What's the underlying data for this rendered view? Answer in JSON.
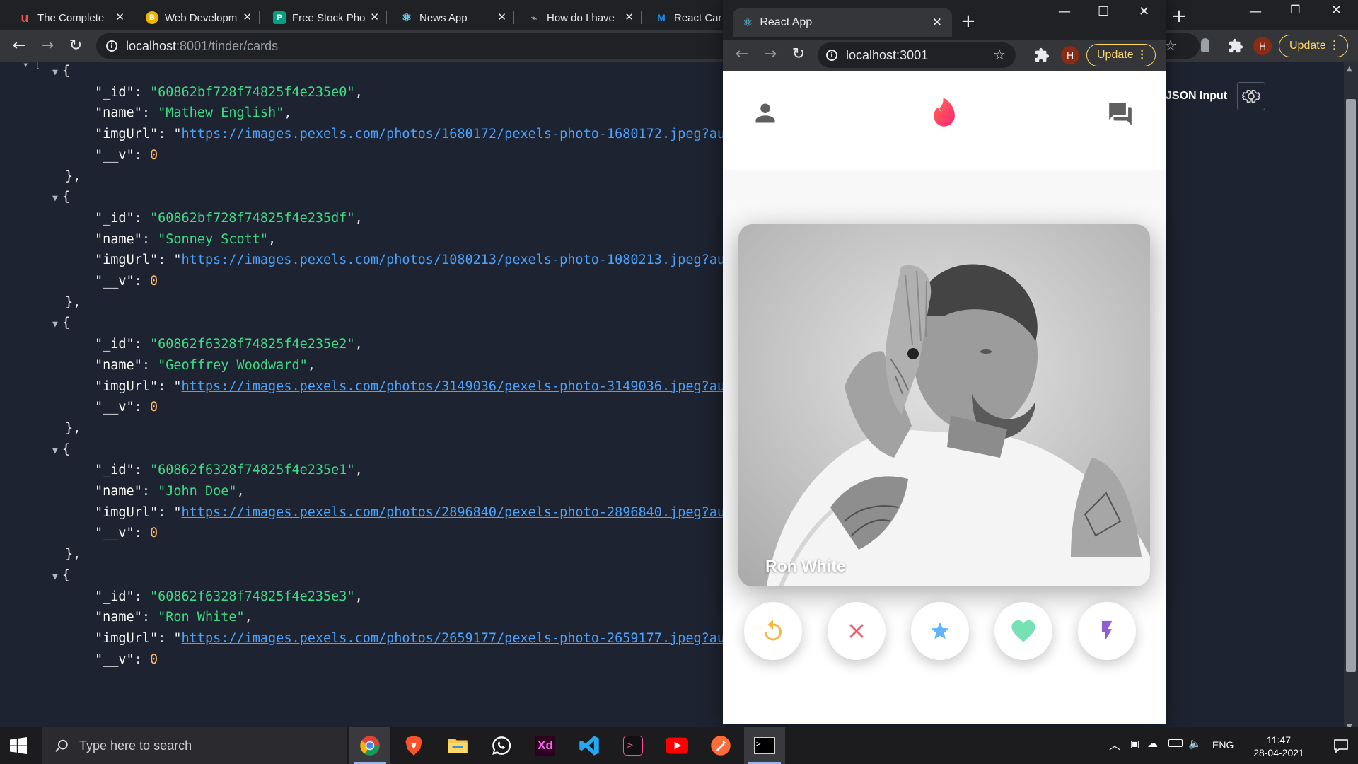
{
  "back_browser": {
    "tabs": [
      {
        "title": "The Complete",
        "icon": "udemy-icon",
        "color": "#a435f0"
      },
      {
        "title": "Web Developm",
        "icon": "bootcamp-icon",
        "color": "#f0b400"
      },
      {
        "title": "Free Stock Pho",
        "icon": "pexels-icon",
        "color": "#05a081"
      },
      {
        "title": "News App",
        "icon": "react-icon",
        "color": "#61dafb"
      },
      {
        "title": "How do I have",
        "icon": "stackoverflow-icon",
        "color": "#f48024"
      },
      {
        "title": "React Car",
        "icon": "mui-icon",
        "color": "#1e88e5"
      }
    ],
    "url_host": "localhost",
    "url_path": ":8001/tinder/cards",
    "update_label": "Update",
    "profile_letter": "H",
    "json_input_label": "JSON Input",
    "records": [
      {
        "_id": "60862bf728f74825f4e235e0",
        "name": "Mathew English",
        "imgUrl": "https://images.pexels.com/photos/1680172/pexels-photo-1680172.jpeg?aut",
        "__v": "0"
      },
      {
        "_id": "60862bf728f74825f4e235df",
        "name": "Sonney Scott",
        "imgUrl": "https://images.pexels.com/photos/1080213/pexels-photo-1080213.jpeg?aut",
        "__v": "0"
      },
      {
        "_id": "60862f6328f74825f4e235e2",
        "name": "Geoffrey Woodward",
        "imgUrl": "https://images.pexels.com/photos/3149036/pexels-photo-3149036.jpeg?aut",
        "__v": "0"
      },
      {
        "_id": "60862f6328f74825f4e235e1",
        "name": "John Doe",
        "imgUrl": "https://images.pexels.com/photos/2896840/pexels-photo-2896840.jpeg?aut",
        "__v": "0"
      },
      {
        "_id": "60862f6328f74825f4e235e3",
        "name": "Ron White",
        "imgUrl": "https://images.pexels.com/photos/2659177/pexels-photo-2659177.jpeg?aut",
        "__v": "0"
      }
    ]
  },
  "popup": {
    "tab_title": "React App",
    "url": "localhost:3001",
    "update_label": "Update",
    "profile_letter": "H",
    "card_name": "Ron White",
    "buttons": [
      {
        "name": "replay-button",
        "icon": "replay-icon",
        "color": "#f5b748"
      },
      {
        "name": "dislike-button",
        "icon": "close-icon",
        "color": "#ec5e6f"
      },
      {
        "name": "superlike-button",
        "icon": "star-icon",
        "color": "#62b4f9"
      },
      {
        "name": "like-button",
        "icon": "heart-icon",
        "color": "#76e2b3"
      },
      {
        "name": "boost-button",
        "icon": "flash-icon",
        "color": "#915dd1"
      }
    ],
    "brand_color": "#fe3c72"
  },
  "taskbar": {
    "search_placeholder": "Type here to search",
    "language": "ENG",
    "time": "11:47",
    "date": "28-04-2021"
  }
}
